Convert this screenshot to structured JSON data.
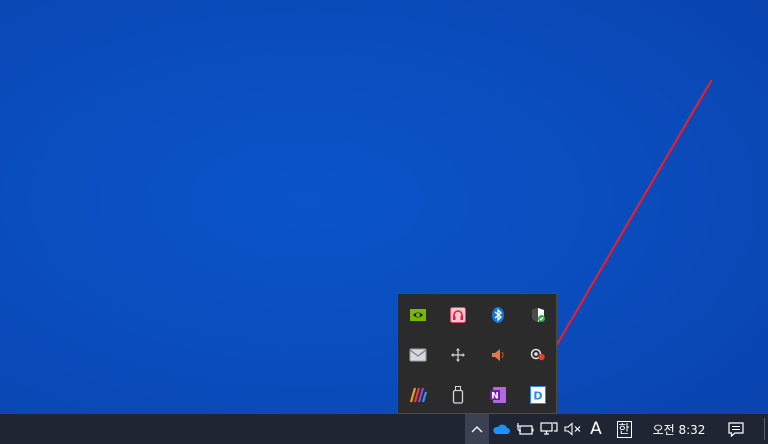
{
  "desktop": {
    "background_color": "#0a4dbe"
  },
  "annotation": {
    "arrow_color": "#e3212e"
  },
  "tray_overflow": {
    "icons": [
      {
        "name": "nvidia-icon"
      },
      {
        "name": "headset-icon"
      },
      {
        "name": "bluetooth-icon"
      },
      {
        "name": "windows-security-icon"
      },
      {
        "name": "mail-icon"
      },
      {
        "name": "move-icon"
      },
      {
        "name": "speaker-icon"
      },
      {
        "name": "record-icon"
      },
      {
        "name": "colorful-app-icon"
      },
      {
        "name": "usb-drive-icon"
      },
      {
        "name": "onenote-icon"
      },
      {
        "name": "d-app-icon"
      }
    ]
  },
  "taskbar": {
    "background_color": "#1f2532",
    "ime_mode": "A",
    "ime_hangul": "한",
    "clock": "오전 8:32"
  }
}
